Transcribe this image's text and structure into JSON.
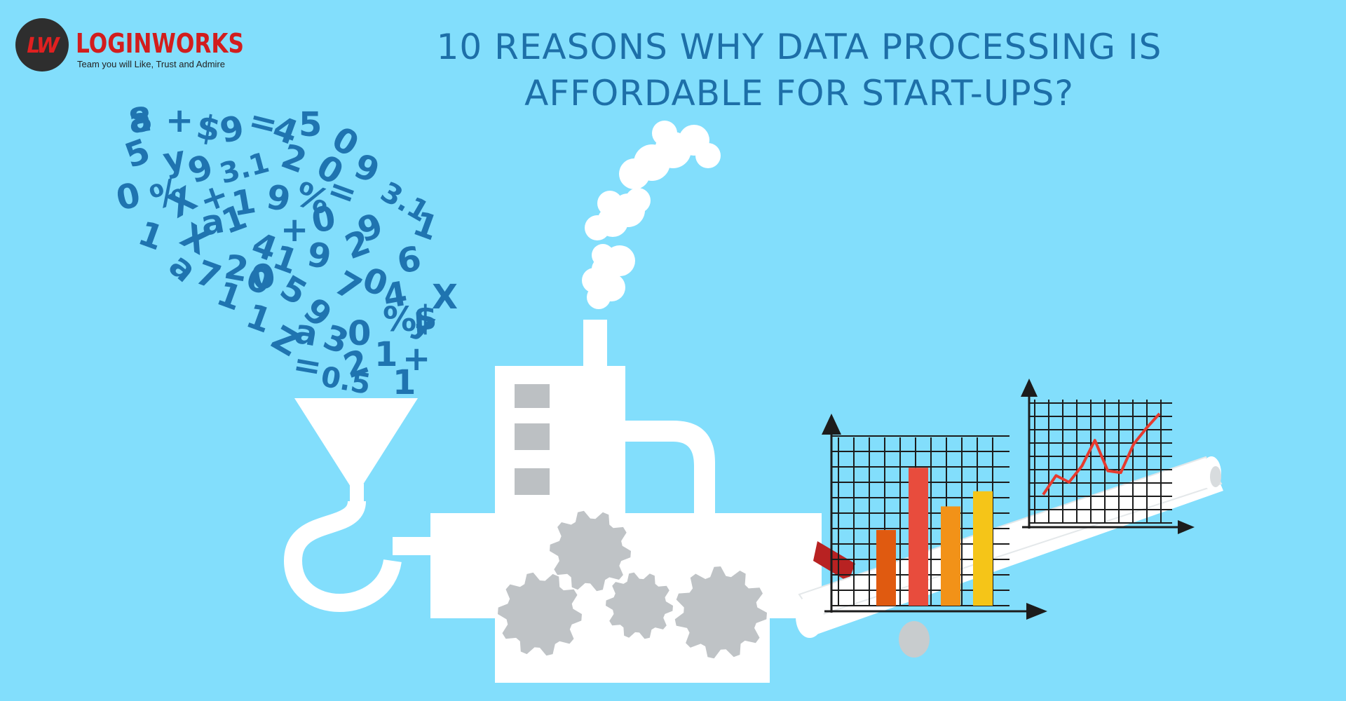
{
  "logo": {
    "badge": "LW",
    "name": "LOGINWORKS",
    "tagline": "Team you will Like, Trust and Admire"
  },
  "headline": {
    "line1": "10 REASONS WHY DATA PROCESSING IS",
    "line2": "AFFORDABLE FOR START-UPS?"
  },
  "data_glyphs": [
    "a",
    "+",
    "$",
    "9",
    "=",
    "4",
    "5",
    "0",
    "5",
    "y",
    "9",
    "3.1",
    "2",
    "0",
    "9",
    "0",
    "%",
    "X",
    "+",
    "1",
    "9",
    "%",
    "=",
    "3.1",
    "1",
    "X",
    "a",
    "1",
    "4",
    "+",
    "0",
    "9",
    "1",
    "a",
    "7",
    "2",
    "0",
    "1",
    "9",
    "2",
    "6",
    "1",
    "0",
    "5",
    "9",
    "7",
    "0",
    "4",
    "y",
    "X",
    "1",
    "Z",
    "a",
    "3",
    "0",
    "%",
    "$",
    "=",
    "0.5",
    "2",
    "1",
    "+",
    "1",
    "8"
  ],
  "colors": {
    "background": "#82defc",
    "headline": "#1d6fa8",
    "glyphs": "#1f74b0",
    "machine": "#ffffff",
    "gears": "#bfc3c6",
    "brand": "#d21d1d"
  },
  "icons": [
    "funnel-icon",
    "factory-machine-icon",
    "gear-icon",
    "conveyor-belt-icon",
    "bar-chart-icon",
    "line-chart-icon",
    "smoke-icon"
  ],
  "bar_chart": {
    "values": [
      0.45,
      0.82,
      0.59,
      0.68
    ],
    "colors": [
      "#e05a10",
      "#e84c3d",
      "#f29218",
      "#f5c518"
    ]
  },
  "line_chart": {
    "values": [
      0.15,
      0.35,
      0.28,
      0.45,
      0.72,
      0.4,
      0.38,
      0.68,
      0.85,
      1.0
    ]
  }
}
